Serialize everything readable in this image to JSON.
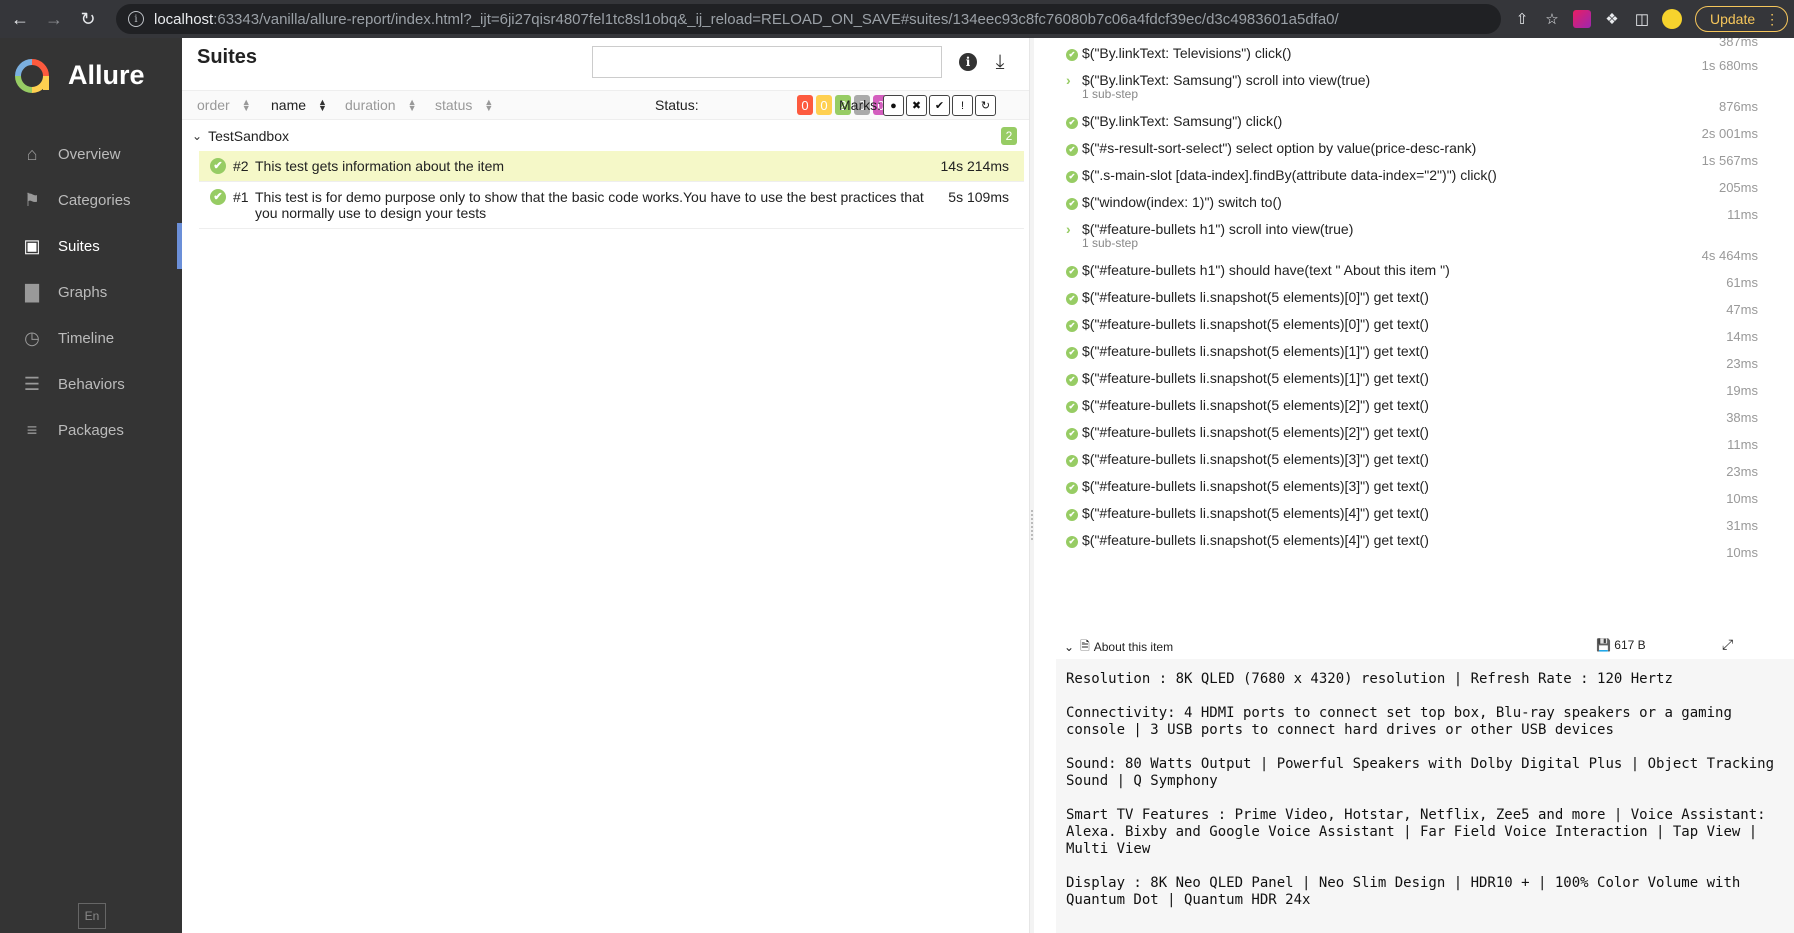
{
  "browser": {
    "url_host": "localhost",
    "url_path": ":63343/vanilla/allure-report/index.html?_ijt=6ji27qisr4807fel1tc8sl1obq&_ij_reload=RELOAD_ON_SAVE#suites/134eec93c8fc76080b7c06a4fdcf39ec/d3c4983601a5dfa0/",
    "update_label": "Update",
    "info_glyph": "i"
  },
  "sidebar": {
    "brand": "Allure",
    "items": [
      {
        "label": "Overview",
        "icon": "home-icon"
      },
      {
        "label": "Categories",
        "icon": "flag-icon"
      },
      {
        "label": "Suites",
        "icon": "briefcase-icon"
      },
      {
        "label": "Graphs",
        "icon": "bar-chart-icon"
      },
      {
        "label": "Timeline",
        "icon": "clock-icon"
      },
      {
        "label": "Behaviors",
        "icon": "list-icon"
      },
      {
        "label": "Packages",
        "icon": "align-left-icon"
      }
    ],
    "active_index": 2,
    "lang": "En"
  },
  "suites": {
    "title": "Suites",
    "search_placeholder": "",
    "sort": {
      "order": "order",
      "name": "name",
      "duration": "duration",
      "status": "status"
    },
    "status_label": "Status:",
    "status_counts": [
      {
        "value": "0",
        "color": "#fd5a3e"
      },
      {
        "value": "0",
        "color": "#ffd050"
      },
      {
        "value": "2",
        "color": "#97cc64"
      },
      {
        "value": "0",
        "color": "#aaaaaa"
      },
      {
        "value": "0",
        "color": "#d35ebe"
      }
    ],
    "marks_label": "Marks:",
    "group": {
      "name": "TestSandbox",
      "count": "2"
    },
    "tests": [
      {
        "num": "#2",
        "name": "This test gets information about the item",
        "duration": "14s 214ms",
        "selected": true
      },
      {
        "num": "#1",
        "name": "This test is for demo purpose only to show that the basic code works.You have to use the best practices that you normally use to design your tests",
        "duration": "5s 109ms",
        "selected": false
      }
    ]
  },
  "steps": {
    "top_duration": "387ms",
    "items": [
      {
        "text": "$(\"By.linkText: Televisions\") click()",
        "duration": "1s 680ms",
        "expandable": false,
        "sub": ""
      },
      {
        "text": "$(\"By.linkText: Samsung\") scroll into view(true)",
        "duration": "876ms",
        "expandable": true,
        "sub": "1 sub-step"
      },
      {
        "text": "$(\"By.linkText: Samsung\") click()",
        "duration": "2s 001ms",
        "expandable": false,
        "sub": ""
      },
      {
        "text": "$(\"#s-result-sort-select\") select option by value(price-desc-rank)",
        "duration": "1s 567ms",
        "expandable": false,
        "sub": ""
      },
      {
        "text": "$(\".s-main-slot [data-index].findBy(attribute data-index=\"2\")\") click()",
        "duration": "205ms",
        "expandable": false,
        "sub": ""
      },
      {
        "text": "$(\"window(index: 1)\") switch to()",
        "duration": "11ms",
        "expandable": false,
        "sub": ""
      },
      {
        "text": "$(\"#feature-bullets h1\") scroll into view(true)",
        "duration": "4s 464ms",
        "expandable": true,
        "sub": "1 sub-step"
      },
      {
        "text": "$(\"#feature-bullets h1\") should have(text \" About this item \")",
        "duration": "61ms",
        "expandable": false,
        "sub": ""
      },
      {
        "text": "$(\"#feature-bullets li.snapshot(5 elements)[0]\") get text()",
        "duration": "47ms",
        "expandable": false,
        "sub": ""
      },
      {
        "text": "$(\"#feature-bullets li.snapshot(5 elements)[0]\") get text()",
        "duration": "14ms",
        "expandable": false,
        "sub": ""
      },
      {
        "text": "$(\"#feature-bullets li.snapshot(5 elements)[1]\") get text()",
        "duration": "23ms",
        "expandable": false,
        "sub": ""
      },
      {
        "text": "$(\"#feature-bullets li.snapshot(5 elements)[1]\") get text()",
        "duration": "19ms",
        "expandable": false,
        "sub": ""
      },
      {
        "text": "$(\"#feature-bullets li.snapshot(5 elements)[2]\") get text()",
        "duration": "38ms",
        "expandable": false,
        "sub": ""
      },
      {
        "text": "$(\"#feature-bullets li.snapshot(5 elements)[2]\") get text()",
        "duration": "11ms",
        "expandable": false,
        "sub": ""
      },
      {
        "text": "$(\"#feature-bullets li.snapshot(5 elements)[3]\") get text()",
        "duration": "23ms",
        "expandable": false,
        "sub": ""
      },
      {
        "text": "$(\"#feature-bullets li.snapshot(5 elements)[3]\") get text()",
        "duration": "10ms",
        "expandable": false,
        "sub": ""
      },
      {
        "text": "$(\"#feature-bullets li.snapshot(5 elements)[4]\") get text()",
        "duration": "31ms",
        "expandable": false,
        "sub": ""
      },
      {
        "text": "$(\"#feature-bullets li.snapshot(5 elements)[4]\") get text()",
        "duration": "10ms",
        "expandable": false,
        "sub": ""
      }
    ]
  },
  "attachment": {
    "title": "About this item",
    "size": "617 B",
    "paragraphs": [
      "Resolution : 8K QLED (7680 x 4320) resolution | Refresh Rate : 120 Hertz",
      "Connectivity: 4 HDMI ports to connect set top box, Blu-ray speakers or a gaming console | 3 USB ports to connect hard drives or other USB devices",
      "Sound: 80 Watts Output | Powerful Speakers with Dolby Digital Plus | Object Tracking Sound | Q Symphony",
      "Smart TV Features : Prime Video, Hotstar, Netflix, Zee5 and more | Voice Assistant: Alexa. Bixby and Google Voice Assistant | Far Field Voice Interaction | Tap View | Multi View",
      "Display : 8K Neo QLED Panel | Neo Slim Design | HDR10 + | 100% Color Volume with Quantum Dot | Quantum HDR 24x"
    ]
  }
}
